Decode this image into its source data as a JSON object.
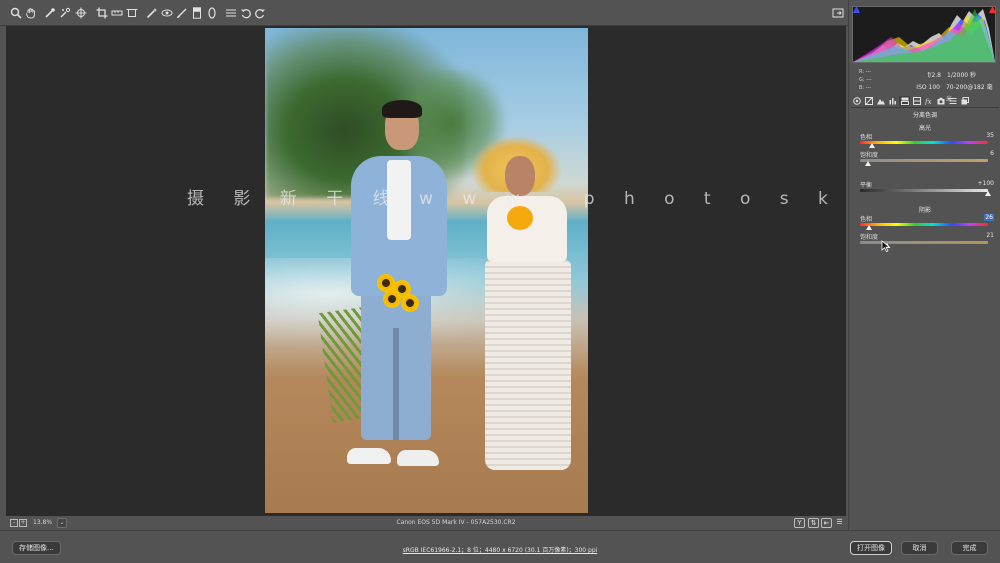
{
  "toolbar": {
    "tools": [
      "zoom-tool",
      "hand-tool",
      "white-balance-tool",
      "color-sampler-tool",
      "targeted-adjustment-tool",
      "crop-tool",
      "straighten-tool",
      "transform-tool",
      "spot-removal-tool",
      "red-eye-tool",
      "adjustment-brush-tool",
      "graduated-filter-tool",
      "radial-filter-tool",
      "presets-tool",
      "rotate-left-tool",
      "rotate-right-tool"
    ]
  },
  "watermark": "摄 影 新 干 线 w w w . p h o t o s k s . v i p",
  "canvas_footer": {
    "zoom": "13.8%",
    "file_info": "Canon EOS 5D Mark IV  -  057A2530.CR2"
  },
  "bottom": {
    "save_label": "存储图像...",
    "workflow_options": "sRGB IEC61966-2.1；8 位；4480 x 6720 (30.1 百万像素)；300 ppi",
    "open_label": "打开图像",
    "cancel_label": "取消",
    "done_label": "完成"
  },
  "info": {
    "r_label": "R:",
    "r_value": "---",
    "g_label": "G:",
    "g_value": "---",
    "b_label": "B:",
    "b_value": "---",
    "aperture": "f/2.8",
    "shutter": "1/2000 秒",
    "iso": "ISO 100",
    "lens": "70-200@182 毫米"
  },
  "split_toning": {
    "panel_title": "分离色调",
    "highlights_title": "高光",
    "highlights": {
      "hue_label": "色相",
      "hue_value": 35,
      "saturation_label": "饱和度",
      "saturation_value": 6
    },
    "balance_label": "平衡",
    "balance_value": "+100",
    "shadows_title": "阴影",
    "shadows": {
      "hue_label": "色相",
      "hue_value": 26,
      "saturation_label": "饱和度",
      "saturation_value": 21
    }
  },
  "colors": {
    "hue_gradient": "linear-gradient(90deg,#ff2a2a,#ffb400,#ffff00,#2bd02b,#00e0e0,#2a4cff,#c23cff,#ff2a2a)",
    "accent_highlight": "#3f6fb7"
  }
}
